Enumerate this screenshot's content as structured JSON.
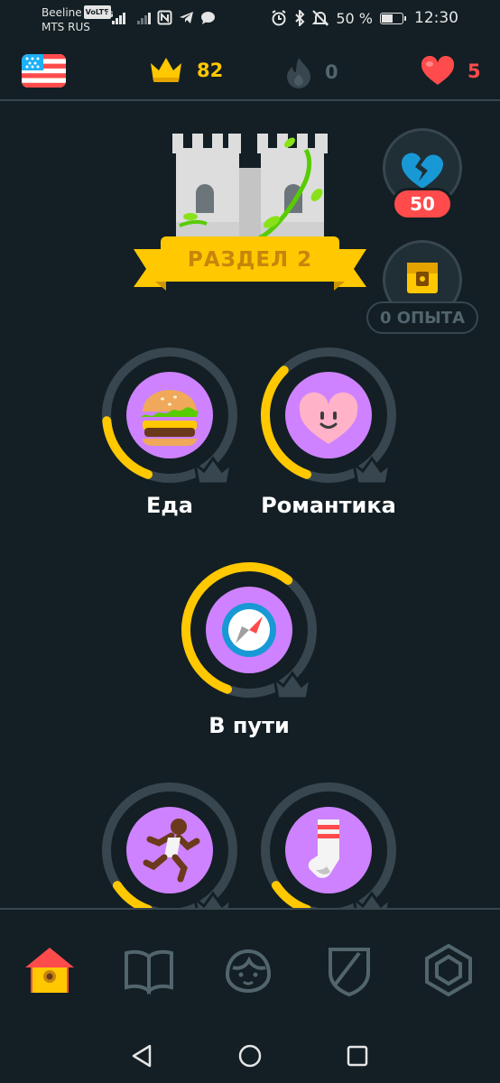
{
  "status_bar": {
    "carrier1": "Beeline",
    "volte": "VoLTE",
    "carrier2": "MTS RUS",
    "network": "4G",
    "battery": "50 %",
    "time": "12:30"
  },
  "top_bar": {
    "language_flag": "us-flag-icon",
    "crowns": "82",
    "streak": "0",
    "hearts": "5"
  },
  "section": {
    "banner": "РАЗДЕЛ 2",
    "broken_heart_count": "50",
    "chest_xp": "0 ОПЫТА"
  },
  "skills": [
    {
      "label": "Еда",
      "icon": "burger-icon",
      "progress": 0.18
    },
    {
      "label": "Романтика",
      "icon": "smiling-heart-icon",
      "progress": 0.32
    },
    {
      "label": "В пути",
      "icon": "compass-icon",
      "progress": 0.55
    },
    {
      "label": "",
      "icon": "running-man-icon",
      "progress": 0.1
    },
    {
      "label": "",
      "icon": "sock-icon",
      "progress": 0.1
    }
  ],
  "bottom_nav": [
    "home-icon",
    "book-icon",
    "characters-icon",
    "shield-icon",
    "diamond-icon"
  ],
  "colors": {
    "background": "#131f24",
    "gold": "#ffc800",
    "purple": "#ce82ff",
    "red": "#ff4b4b",
    "ring_gray": "#37464f"
  }
}
